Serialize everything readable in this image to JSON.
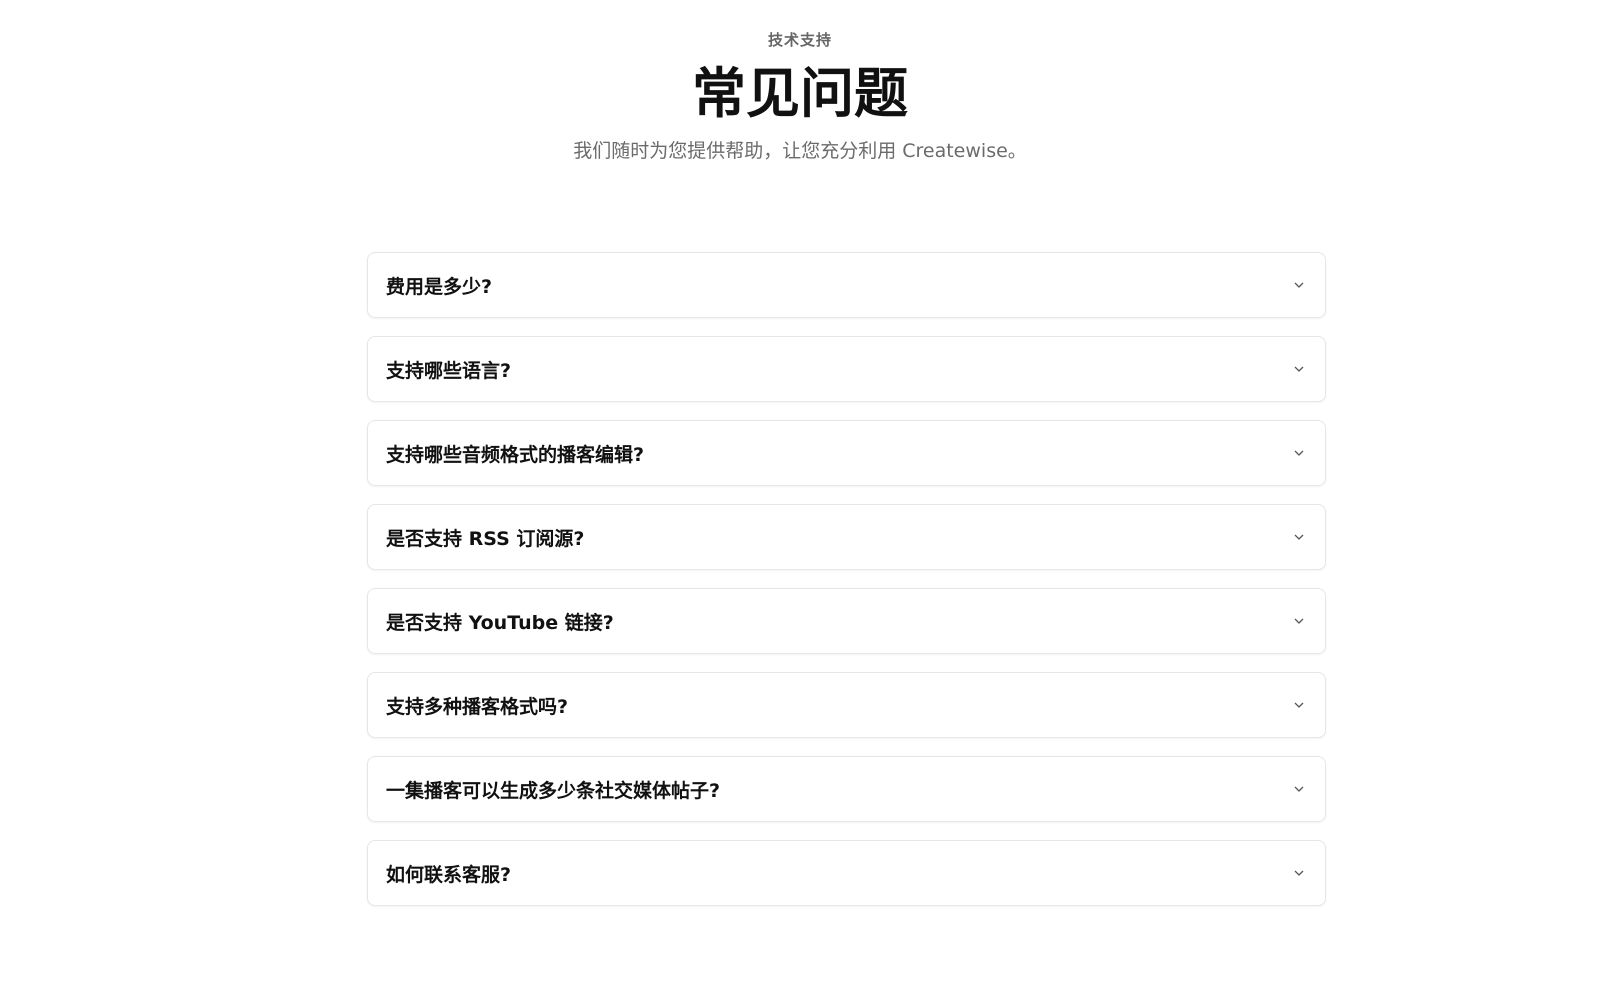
{
  "header": {
    "eyebrow": "技术支持",
    "title": "常见问题",
    "subtitle": "我们随时为您提供帮助，让您充分利用 Createwise。"
  },
  "faq": {
    "items": [
      {
        "question": "费用是多少?",
        "icon": "chevron-down-icon"
      },
      {
        "question": "支持哪些语言?",
        "icon": "chevron-down-icon"
      },
      {
        "question": "支持哪些音频格式的播客编辑?",
        "icon": "chevron-down-icon"
      },
      {
        "question": "是否支持 RSS 订阅源?",
        "icon": "chevron-down-icon"
      },
      {
        "question": "是否支持 YouTube 链接?",
        "icon": "chevron-down-icon"
      },
      {
        "question": "支持多种播客格式吗?",
        "icon": "chevron-down-icon"
      },
      {
        "question": "一集播客可以生成多少条社交媒体帖子?",
        "icon": "chevron-down-icon"
      },
      {
        "question": "如何联系客服?",
        "icon": "chevron-down-icon"
      }
    ]
  },
  "colors": {
    "text": "#111111",
    "muted": "#6b6b6b",
    "border": "#e6e6e6",
    "background": "#ffffff"
  }
}
